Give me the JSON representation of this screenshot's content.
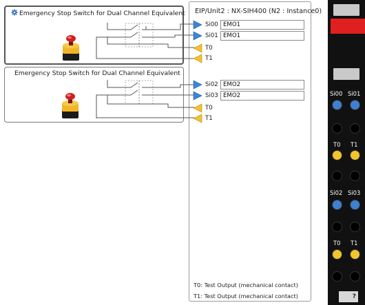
{
  "blocks": [
    {
      "title": "Emergency Stop Switch for Dual Channel Equivalent",
      "icon": "gear-icon"
    },
    {
      "title": "Emergency Stop Switch for Dual Channel Equivalent"
    }
  ],
  "unit": {
    "header": "EIP/Unit2 : NX-SIH400 (N2 : Instance0)",
    "ports": [
      {
        "label": "Si00",
        "value": "EMO1"
      },
      {
        "label": "Si01",
        "value": "EMO1"
      },
      {
        "label": "T0"
      },
      {
        "label": "T1"
      },
      {
        "label": "Si02",
        "value": "EMO2"
      },
      {
        "label": "Si03",
        "value": "EMO2"
      },
      {
        "label": "T0"
      },
      {
        "label": "T1"
      }
    ],
    "legend": [
      "T0: Test Output (mechanical contact)",
      "T1: Test Output (mechanical contact)"
    ]
  },
  "terminal": {
    "labels": [
      "Si00",
      "Si01",
      "T0",
      "T1",
      "Si02",
      "Si03",
      "T0",
      "T1"
    ],
    "help": "?"
  },
  "colors": {
    "input_arrow": "#3d86d6",
    "output_arrow": "#f2c230",
    "button_red": "#cc2222",
    "button_yellow": "#f2b52a",
    "terminal_bg": "#111111"
  }
}
